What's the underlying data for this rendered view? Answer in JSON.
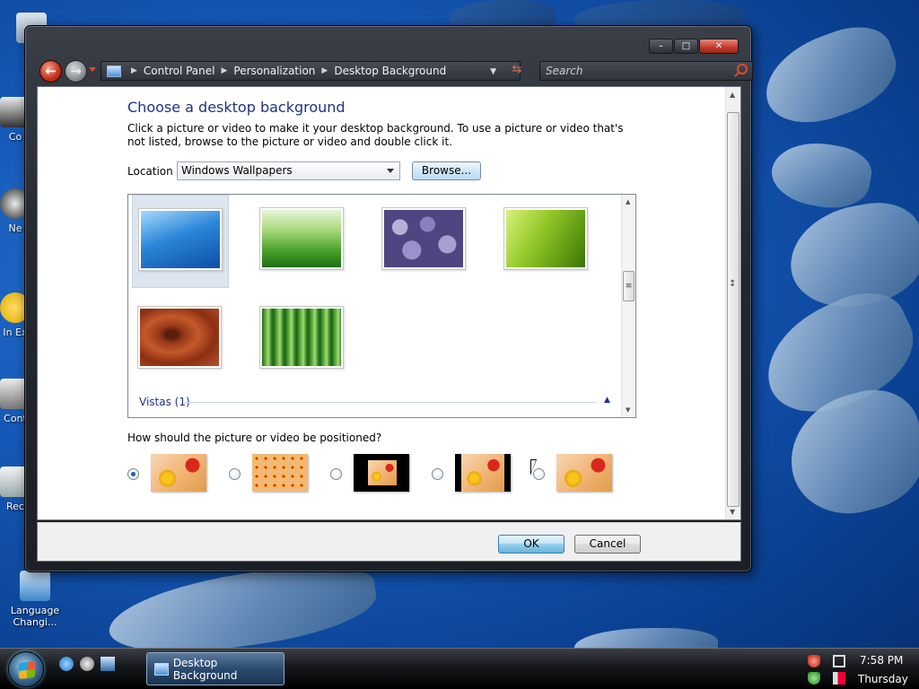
{
  "desktop": {
    "icons": [
      {
        "label": "Co",
        "name": "computer"
      },
      {
        "label": "Ne",
        "name": "network"
      },
      {
        "label": "In Ex",
        "name": "internet-explorer"
      },
      {
        "label": "Cont",
        "name": "control-panel"
      },
      {
        "label": "Rec",
        "name": "recycle-bin"
      },
      {
        "label": "Language Changi...",
        "name": "language-changer"
      }
    ]
  },
  "window": {
    "breadcrumbs": [
      "Control Panel",
      "Personalization",
      "Desktop Background"
    ],
    "search_placeholder": "Search",
    "title": "Choose a desktop background",
    "description": "Click a picture or video to make it your desktop background. To use a picture or video that's not listed, browse to the picture or video and double click it.",
    "location_label": "Location",
    "location_value": "Windows Wallpapers",
    "browse_label": "Browse...",
    "gallery": {
      "group_label": "Vistas (1)",
      "selected_index": 0,
      "images": [
        "underwater-fish",
        "green-grass",
        "purple-stones",
        "green-leaf",
        "wood-knot",
        "bamboo"
      ]
    },
    "position_question": "How should the picture or video be positioned?",
    "position_options": [
      "Fit to screen",
      "Tile",
      "Center",
      "Fit",
      "Fill"
    ],
    "position_selected": 0,
    "ok_label": "OK",
    "cancel_label": "Cancel"
  },
  "taskbar": {
    "active_window_label": "Desktop Background",
    "time": "7:58 PM",
    "day": "Thursday"
  },
  "colors": {
    "title_blue": "#1e3287",
    "taskbar_black": "#000000",
    "close_red": "#c0392b",
    "desktop_blue": "#1559b8"
  }
}
